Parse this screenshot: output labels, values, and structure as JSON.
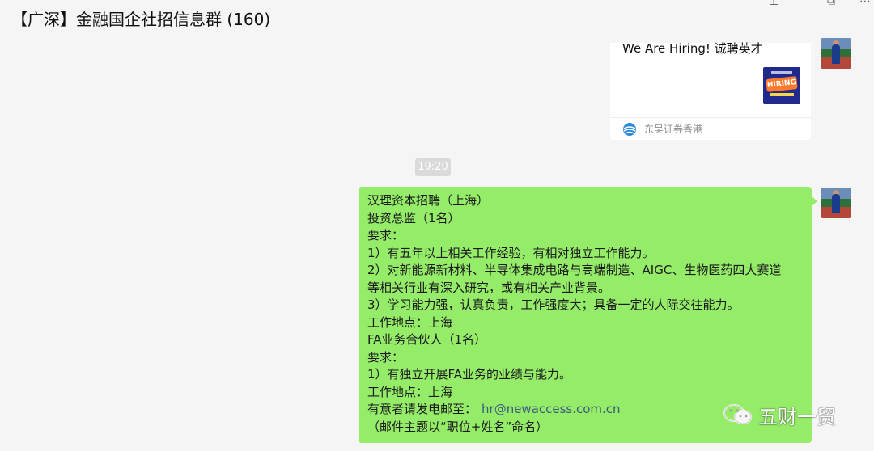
{
  "window": {
    "title": "【广深】金融国企社招信息群 (160)",
    "controls": {
      "pin": "⊥",
      "restore": "⧉",
      "more": "⋯"
    }
  },
  "card": {
    "title": "We Are Hiring! 诚聘英才",
    "thumbnail_text": "HIRING",
    "source": "东吴证券香港",
    "icon": "globe-icon"
  },
  "timestamp": "19:20",
  "message": {
    "lines": [
      "汉理资本招聘（上海）",
      "投资总监（1名）",
      "要求：",
      "1）有五年以上相关工作经验，有相对独立工作能力。",
      "2）对新能源新材料、半导体集成电路与高端制造、AIGC、生物医药四大赛道",
      "等相关行业有深入研究，或有相关产业背景。",
      "3）学习能力强，认真负责，工作强度大；具备一定的人际交往能力。",
      "工作地点：上海",
      "FA业务合伙人（1名）",
      "要求：",
      "1）有独立开展FA业务的业绩与能力。",
      "工作地点：上海"
    ],
    "email_label": "有意者请发电邮至：",
    "email": "hr@newaccess.com.cn",
    "last_line": "（邮件主题以“职位+姓名”命名）"
  },
  "watermark": {
    "text": "五财一贸",
    "icon": "wechat-icon"
  },
  "colors": {
    "bubble": "#95ec69",
    "background": "#f5f5f5",
    "link": "#3c5a7d"
  }
}
